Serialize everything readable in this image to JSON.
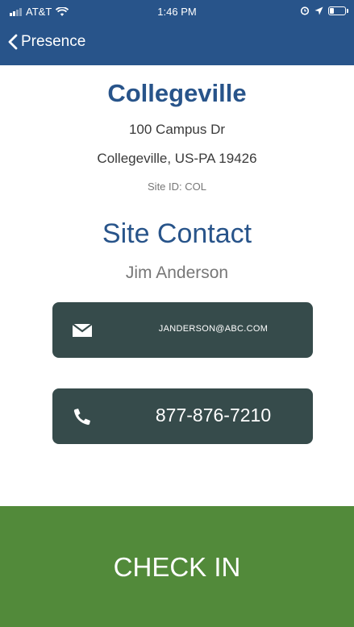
{
  "status_bar": {
    "carrier": "AT&T",
    "time": "1:46 PM",
    "icons": [
      "signal-icon",
      "wifi-icon",
      "alarm-icon",
      "location-icon",
      "battery-icon"
    ],
    "battery_level": 0.25
  },
  "nav": {
    "back_label": "Presence"
  },
  "site": {
    "name": "Collegeville",
    "address_line1": "100 Campus Dr",
    "address_line2": "Collegeville, US-PA 19426",
    "site_id": "Site ID: COL"
  },
  "contact": {
    "heading": "Site Contact",
    "name": "Jim Anderson",
    "email": "JANDERSON@ABC.COM",
    "phone": "877-876-7210"
  },
  "actions": {
    "check_in_label": "CHECK IN"
  },
  "colors": {
    "header_bg": "#28548a",
    "title": "#28548a",
    "contact_button_bg": "#364b4b",
    "check_in_bg": "#528a3a"
  }
}
